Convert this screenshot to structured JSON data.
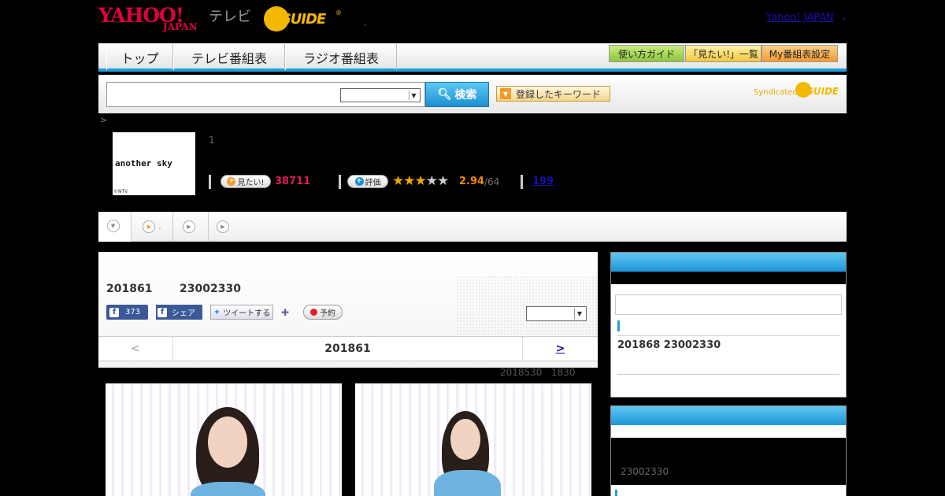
{
  "header": {
    "yahoo_logo": "YAHOO!",
    "yahoo_japan": "JAPAN",
    "tv_label": "テレビ",
    "gguide_logo": "GUIDE",
    "gguide_reg": "®",
    "header_dot": ",",
    "yahoo_japan_link": "Yahoo! JAPAN",
    "header_dot2": ","
  },
  "nav": {
    "tabs": [
      {
        "label": "トップ"
      },
      {
        "label": "テレビ番組表"
      },
      {
        "label": "ラジオ番組表"
      }
    ],
    "buttons": {
      "guide": "使い方ガイド",
      "mitai_list": "「見たい!」一覧",
      "my_schedule": "My番組表設定"
    }
  },
  "search": {
    "input_value": "",
    "select_value": "",
    "button_label": "検索",
    "keyword_button_label": "登録したキーワード",
    "syndicated": "Syndicated",
    "syn_logo": "GUIDE"
  },
  "breadcrumb": ">",
  "program": {
    "thumb_title": "another sky",
    "thumb_credit": "©NTV",
    "episode_count": "1",
    "mitai_label": "見たい!",
    "mitai_count": "38711",
    "rate_label": "評価",
    "rating_value": "2.94",
    "rating_max": "/64",
    "review_count": "199",
    "stars": [
      "on",
      "on",
      "half",
      "off",
      "off"
    ]
  },
  "sub_tabs": [
    {
      "label": ""
    },
    {
      "label": "."
    },
    {
      "label": ""
    },
    {
      "label": ""
    }
  ],
  "main": {
    "air_date": "201861",
    "air_time": "23002330",
    "fb_count": "373",
    "fb_share_label": "シェア",
    "tweet_label": "ツイートする",
    "reserve_label": "予約",
    "panel_select_value": "",
    "prev_label": "<",
    "nav_date": "201861",
    "next_label": ">",
    "update_date": "2018530",
    "update_time": "1830"
  },
  "sidebar": {
    "info": "201868  23002330",
    "time2": "23002330"
  },
  "colors": {
    "accent_blue": "#1ea0dc",
    "brand_red": "#e0003c",
    "gguide_yellow": "#f3b800",
    "mitai_pink": "#e0195a",
    "rating_orange": "#f38a00"
  }
}
